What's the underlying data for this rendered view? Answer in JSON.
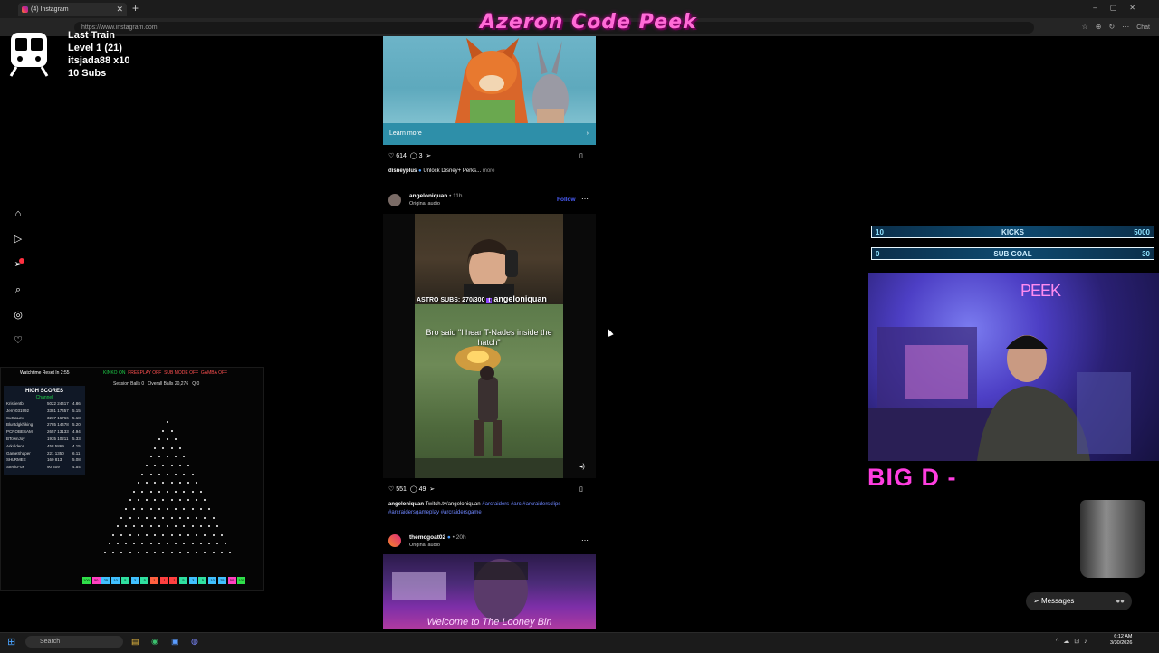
{
  "browser": {
    "tab_title": "(4) Instagram",
    "url": "https://www.instagram.com",
    "chat_label": "Chat"
  },
  "stream": {
    "title": "Azeron Code Peek"
  },
  "train": {
    "line1": "Last Train",
    "line2": "Level 1  (21)",
    "line3": "itsjada88 x10",
    "line4": "10 Subs"
  },
  "nav": {
    "icons": [
      "home-icon",
      "reels-icon",
      "messages-icon",
      "search-icon",
      "explore-icon",
      "notifications-icon"
    ]
  },
  "plinko": {
    "watchtime": "Watchtime Reset In 2:55",
    "status": {
      "kinko": "KINKO ON",
      "freeplay": "FREEPLAY OFF",
      "submode": "SUB MODE OFF",
      "gamba": "GAMBA OFF"
    },
    "session_balls": "Session Balls  0",
    "overall_balls": "Overall Balls  20,276",
    "q": "Q  0",
    "high_scores_title": "HIGH SCORES",
    "high_scores_sub": "Channel",
    "scores": [
      {
        "name": "Kristientb",
        "v1": "5022 24417",
        "v2": "4.86"
      },
      {
        "name": "Jerry031992",
        "v1": "3381 17457",
        "v2": "5.15"
      },
      {
        "name": "SuGaLaV",
        "v1": "3237 16766",
        "v2": "5.18"
      },
      {
        "name": "Bluntdgkhiking",
        "v1": "2785 14478",
        "v2": "5.20"
      },
      {
        "name": "PCROBESAM",
        "v1": "2657 13133",
        "v2": "4.94"
      },
      {
        "name": "BTownJoy",
        "v1": "1935 10211",
        "v2": "5.33"
      },
      {
        "name": "Arkoldenn",
        "v1": "458 5869",
        "v2": "4.15"
      },
      {
        "name": "GameShaper",
        "v1": "221 1350",
        "v2": "6.11"
      },
      {
        "name": "SHLRMEE",
        "v1": "160 813",
        "v2": "5.08"
      },
      {
        "name": "StevicFox",
        "v1": "90 409",
        "v2": "4.54"
      }
    ],
    "slots": [
      "100",
      "50",
      "25",
      "10",
      "5",
      "3",
      "5",
      "1",
      "-1",
      "-1",
      "5",
      "3",
      "5",
      "10",
      "25",
      "50",
      "100"
    ]
  },
  "feed": {
    "ad": {
      "cta": "Learn more",
      "likes": "614",
      "comments": "3",
      "caption_user": "disneyplus",
      "caption_text": "Unlock Disney+ Perks...",
      "caption_more": "more"
    },
    "post2": {
      "username": "angeloniquan",
      "time": "11h",
      "audio": "Original audio",
      "follow": "Follow",
      "overlay_text": "ASTRO SUBS: 270/300",
      "overlay_handle": "angeloniquan",
      "video_caption": "Bro said \"I hear T-Nades inside the hatch\"",
      "likes": "551",
      "comments": "49",
      "caption_user": "angeloniquan",
      "caption_text": "Twitch.tv/angeloniquan",
      "tags_line1": "#arcraiders #arc #arcraidersclips",
      "tags_line2": "#arcraidersgameplay #arcraidersgame"
    },
    "post3": {
      "username": "themcgoat02",
      "time": "20h",
      "audio": "Original audio",
      "image_text": "Welcome to The Looney Bin"
    }
  },
  "overlays": {
    "kicks": {
      "left": "10",
      "label": "KICKS",
      "right": "5000"
    },
    "subgoal": {
      "left": "0",
      "label": "SUB GOAL",
      "right": "30"
    },
    "webcam_label": "PEEK",
    "bigd": "BIG D -",
    "messages": "Messages"
  },
  "taskbar": {
    "search": "Search",
    "time": "6:12 AM",
    "date": "3/30/2026"
  },
  "colors": {
    "accent_pink": "#ff3ee0",
    "ig_blue": "#4a5df9",
    "goal_cyan": "#8fe3ff"
  }
}
